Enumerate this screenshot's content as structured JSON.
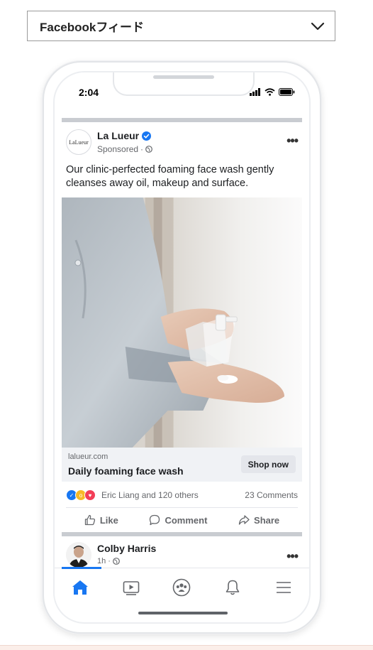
{
  "placement": {
    "label": "Facebookフィード"
  },
  "status_bar": {
    "time": "2:04"
  },
  "ad_post": {
    "page_name": "La Lueur",
    "avatar_text": "LaLueur",
    "sponsored": "Sponsored",
    "text": "Our clinic-perfected foaming face wash gently cleanses away oil, makeup and surface.",
    "link": {
      "domain": "lalueur.com",
      "title": "Daily foaming face wash",
      "cta": "Shop now"
    },
    "reactions": {
      "names": "Eric Liang and 120 others",
      "comments": "23 Comments"
    },
    "actions": {
      "like": "Like",
      "comment": "Comment",
      "share": "Share"
    }
  },
  "next_post": {
    "name": "Colby Harris",
    "time": "1h"
  },
  "colors": {
    "accent": "#1877f2",
    "link_bar_bg": "#f0f2f5",
    "divider": "#c9ccd1"
  },
  "icons": {
    "tabs": [
      "home-icon",
      "video-icon",
      "groups-icon",
      "bell-icon",
      "menu-icon"
    ]
  }
}
